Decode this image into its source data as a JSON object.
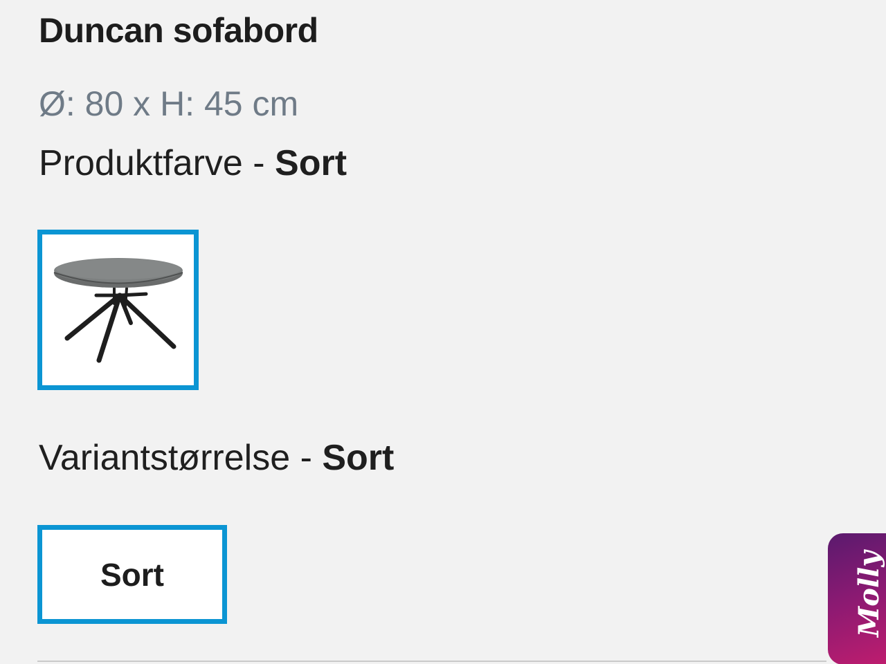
{
  "product": {
    "title": "Duncan sofabord",
    "dimensions": "Ø: 80 x H: 45 cm"
  },
  "color_option": {
    "label": "Produktfarve - ",
    "value": "Sort",
    "swatch_icon": "round-coffee-table-image",
    "selected_border_color": "#0b95d3"
  },
  "size_option": {
    "label": "Variantstørrelse - ",
    "value": "Sort",
    "button_label": "Sort",
    "selected_border_color": "#0b95d3"
  },
  "chat_widget": {
    "label": "Molly",
    "colors": [
      "#5a1a6e",
      "#c21d6e"
    ]
  }
}
